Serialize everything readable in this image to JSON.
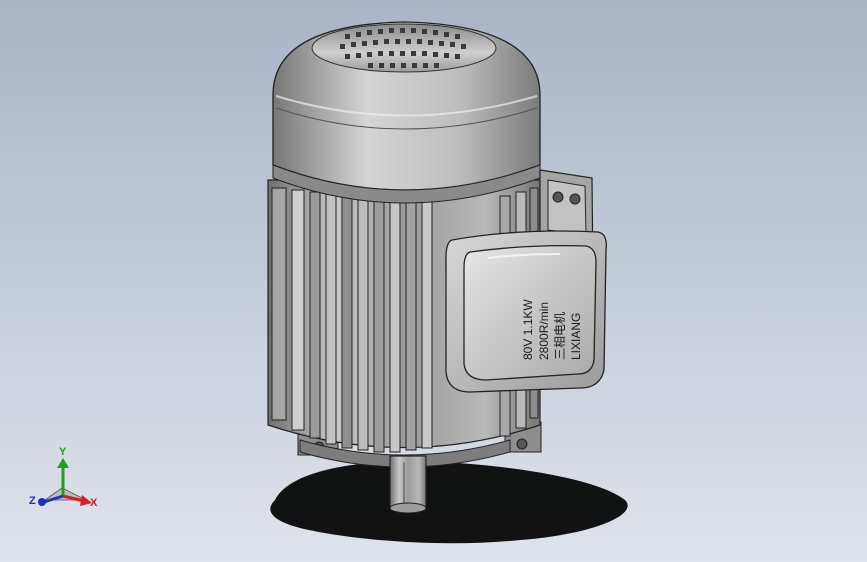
{
  "viewport": {
    "background_top": "#a9b4c6",
    "background_bottom": "#dfe3eb"
  },
  "model": {
    "name": "motor-model",
    "nameplate": {
      "line1": "80V 1.1KW",
      "line2": "2800R/min",
      "line3": "三相电机",
      "line4": "LIXIANG"
    }
  },
  "triad": {
    "x_label": "X",
    "y_label": "Y",
    "z_label": "Z",
    "x_color": "#d42020",
    "y_color": "#20a020",
    "z_color": "#2030c0"
  }
}
